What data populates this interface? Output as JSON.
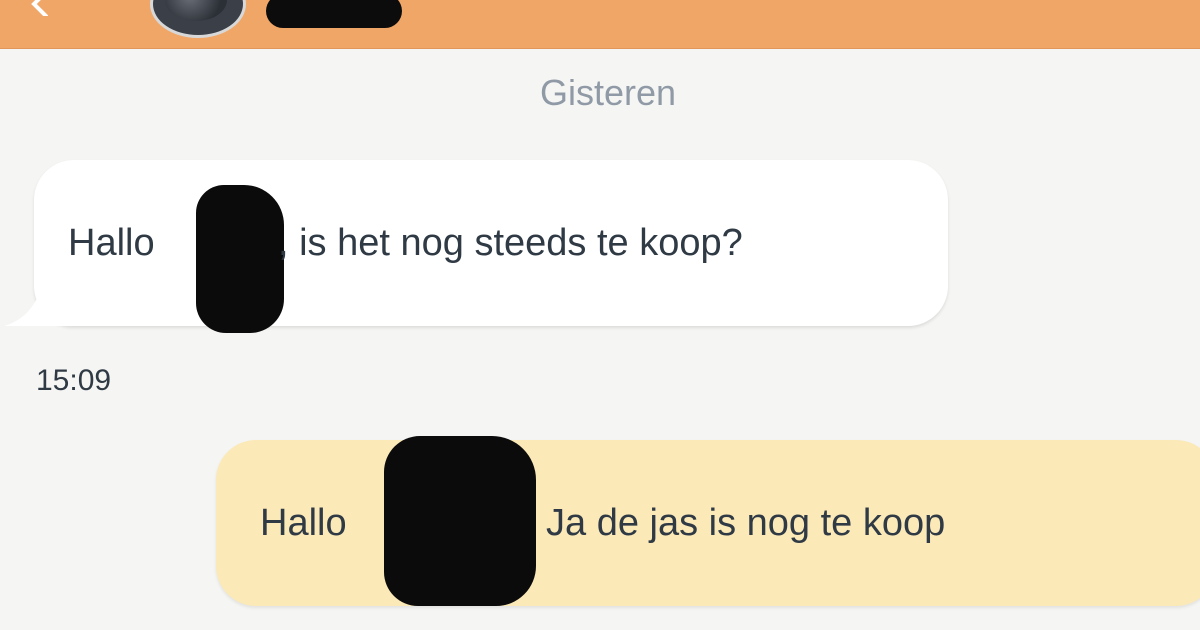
{
  "header": {
    "back_icon": "back-arrow-icon",
    "background_color": "#f0a666"
  },
  "conversation": {
    "date_divider": "Gisteren",
    "messages": [
      {
        "direction": "incoming",
        "greeting": "Hallo",
        "text": ", is het nog steeds te koop?",
        "bubble_color": "#ffffff"
      },
      {
        "direction": "outgoing",
        "greeting": "Hallo",
        "text": "Ja de jas is nog te koop",
        "bubble_color": "#fbe9b8"
      }
    ],
    "timestamp": "15:09"
  }
}
